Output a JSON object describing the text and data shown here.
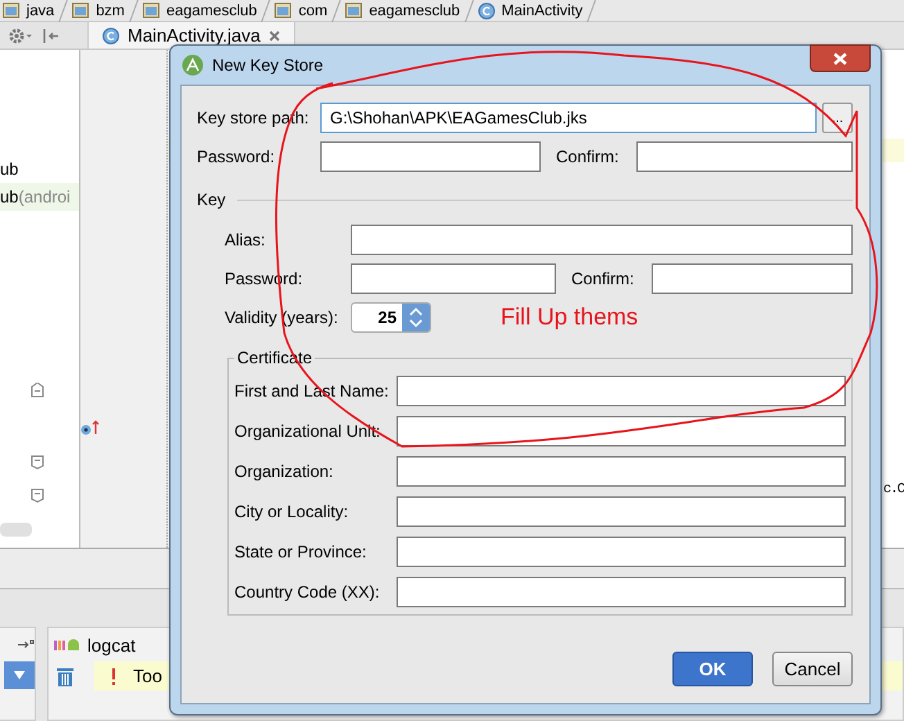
{
  "breadcrumbs": [
    {
      "label": "java",
      "kind": "folder"
    },
    {
      "label": "bzm",
      "kind": "folder"
    },
    {
      "label": "eagamesclub",
      "kind": "folder"
    },
    {
      "label": "com",
      "kind": "folder"
    },
    {
      "label": "eagamesclub",
      "kind": "folder"
    },
    {
      "label": "MainActivity",
      "kind": "class"
    }
  ],
  "editor_tab": {
    "label": "MainActivity.java"
  },
  "project_tree": [
    {
      "name": "ub",
      "selected": false
    },
    {
      "name": "ub",
      "suffix": "(androi",
      "selected": true
    }
  ],
  "code_fragment": "c.C",
  "bottom_panel": {
    "tab": "logcat",
    "message": "Too"
  },
  "dialog": {
    "title": "New Key Store",
    "keystore": {
      "path_label": "Key store path:",
      "path_value": "G:\\Shohan\\APK\\EAGamesClub.jks",
      "browse": "...",
      "password_label": "Password:",
      "confirm_label": "Confirm:"
    },
    "key": {
      "title": "Key",
      "alias_label": "Alias:",
      "password_label": "Password:",
      "confirm_label": "Confirm:",
      "validity_label": "Validity (years):",
      "validity_value": "25"
    },
    "certificate": {
      "title": "Certificate",
      "fields": [
        "First and Last Name:",
        "Organizational Unit:",
        "Organization:",
        "City or Locality:",
        "State or Province:",
        "Country Code (XX):"
      ]
    },
    "annotation": "Fill Up thems",
    "buttons": [
      {
        "label": "OK",
        "default": true
      },
      {
        "label": "Cancel",
        "default": false
      }
    ]
  }
}
